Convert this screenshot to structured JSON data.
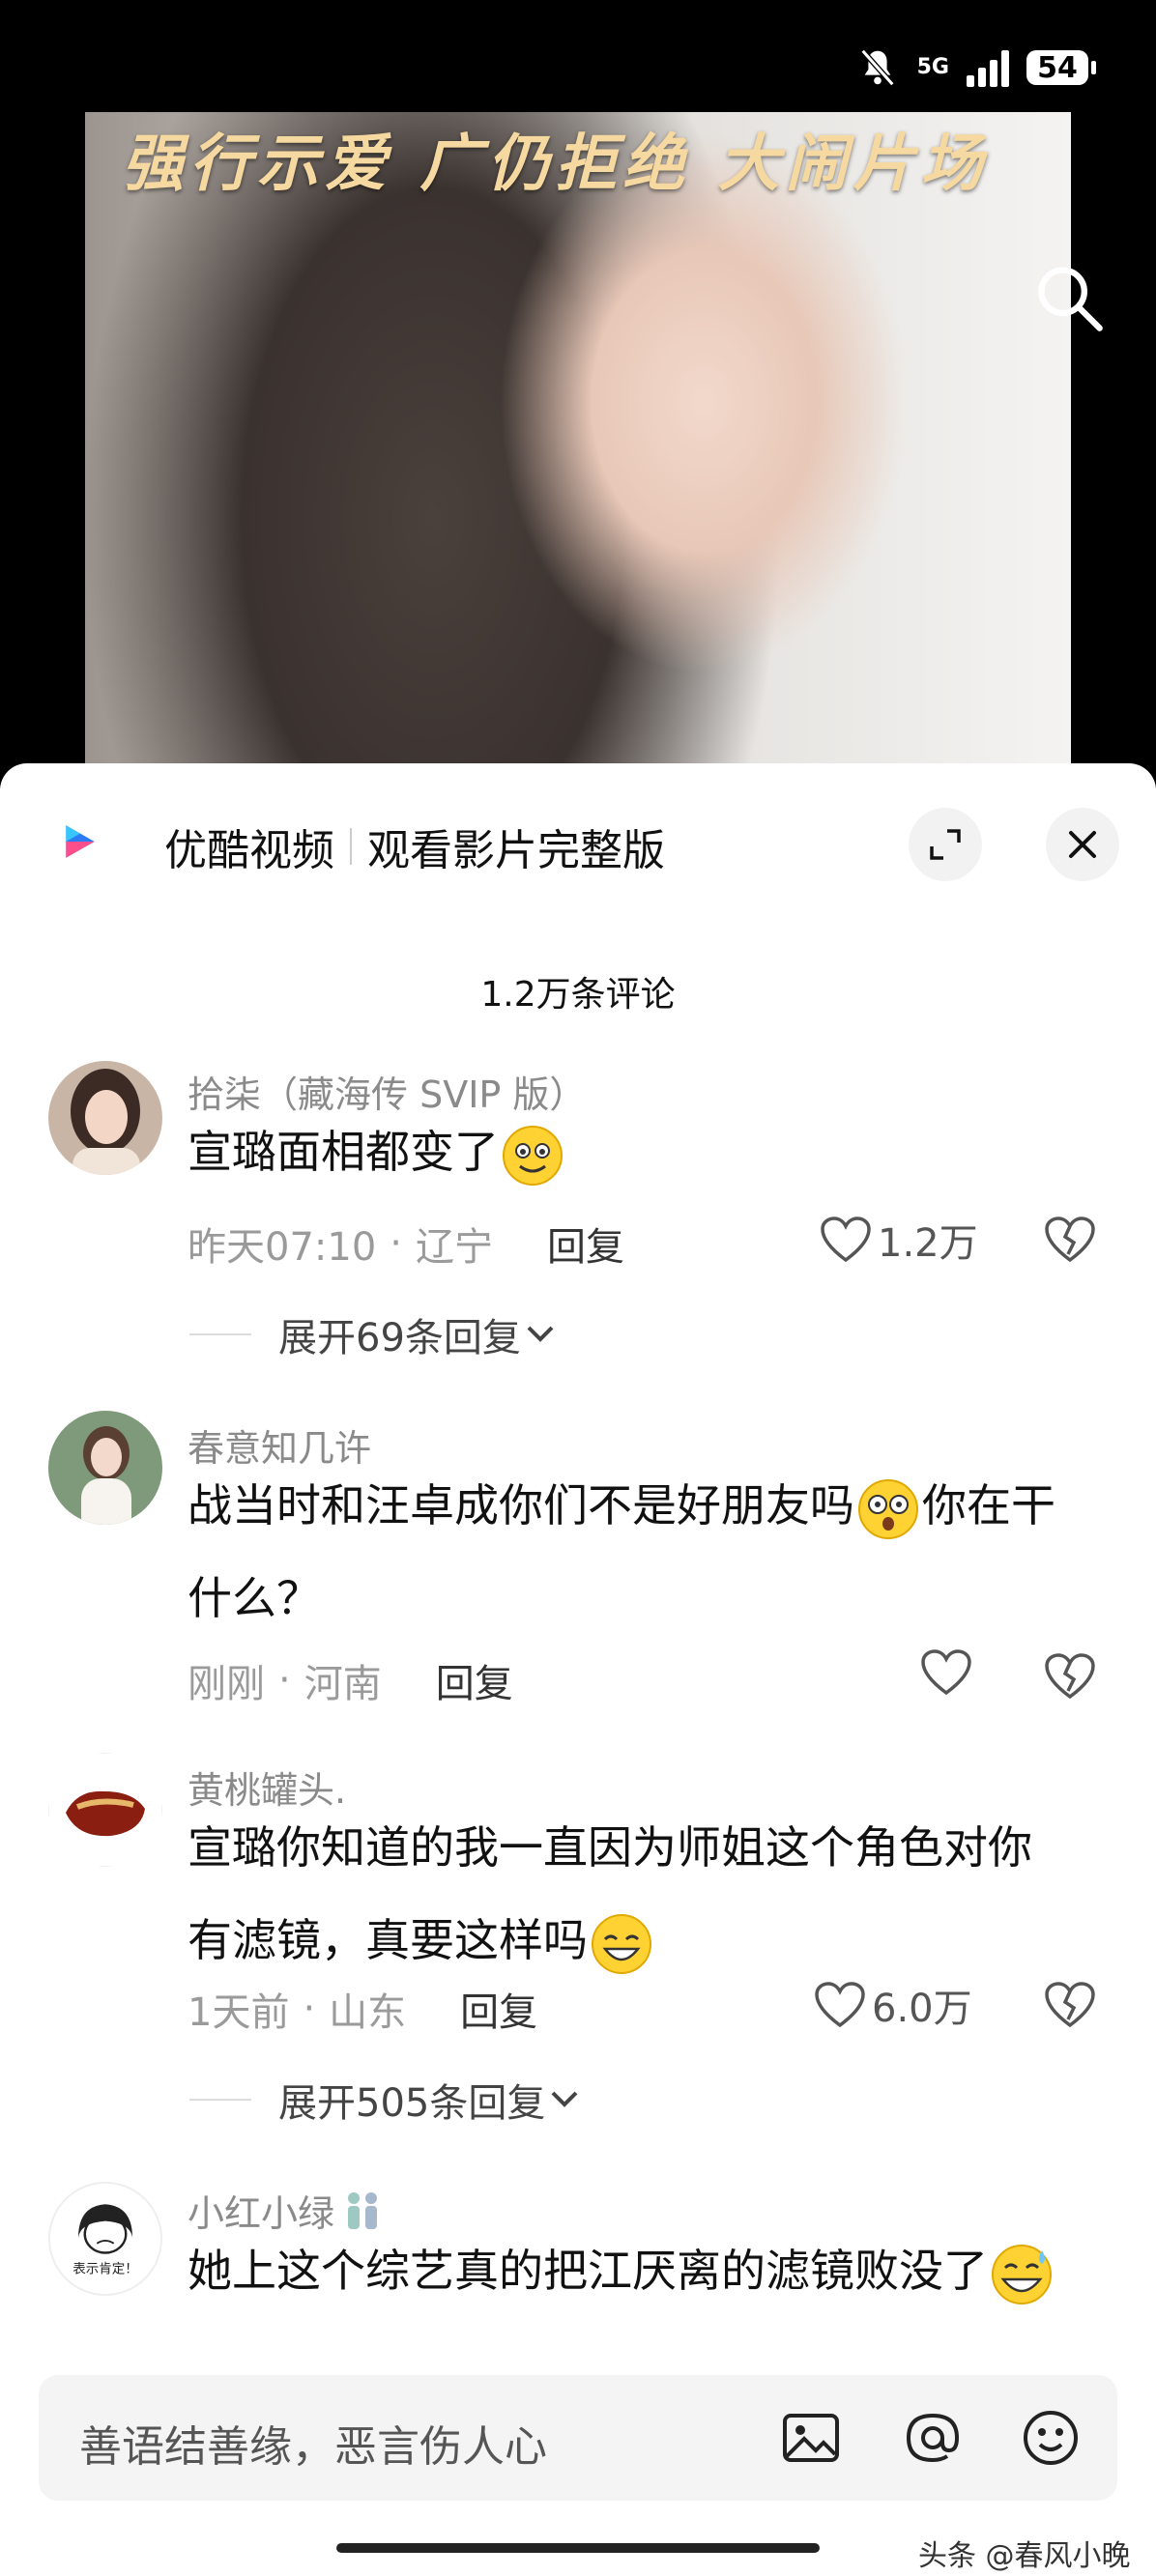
{
  "status_bar": {
    "network": "5G",
    "battery": "54"
  },
  "video": {
    "caption": "强行示爱 广仍拒绝 大闹片场"
  },
  "sheet": {
    "app_name": "优酷视频",
    "cta": "观看影片完整版",
    "comment_count": "1.2万条评论"
  },
  "comments": [
    {
      "name": "拾柒（藏海传 SVIP 版）",
      "text": "宣璐面相都变了",
      "time": "昨天07:10",
      "sep": "·",
      "location": "辽宁",
      "reply": "回复",
      "likes": "1.2万",
      "expand": "展开69条回复"
    },
    {
      "name": "春意知几许",
      "text1": "战当时和汪卓成你们不是好朋友吗",
      "text2": "你在干",
      "text3": "什么？",
      "time": "刚刚",
      "sep": "·",
      "location": "河南",
      "reply": "回复"
    },
    {
      "name": "黄桃罐头.",
      "text1": "宣璐你知道的我一直因为师姐这个角色对你",
      "text2": "有滤镜，真要这样吗",
      "time": "1天前",
      "sep": "·",
      "location": "山东",
      "reply": "回复",
      "likes": "6.0万",
      "expand": "展开505条回复",
      "avatar_text": ""
    },
    {
      "name": "小红小绿",
      "text": "她上这个综艺真的把江厌离的滤镜败没了",
      "avatar_text": "表示肯定！"
    }
  ],
  "input": {
    "placeholder": "善语结善缘，恶言伤人心"
  },
  "watermark": "头条 @春风小晚",
  "colors": {
    "accent_logo_blue": "#2d7cf6",
    "accent_logo_pink": "#ff4f8b",
    "emoji_yellow": "#ffd233"
  }
}
